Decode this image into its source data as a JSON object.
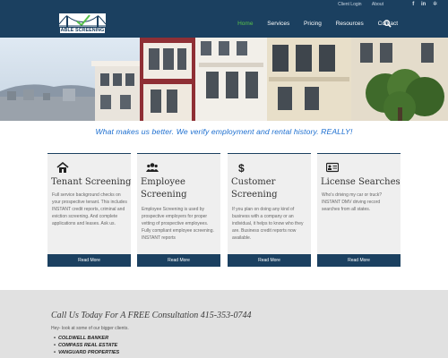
{
  "utility": {
    "links": [
      "Client Login",
      "About"
    ],
    "social": [
      {
        "name": "facebook-icon",
        "glyph": "f"
      },
      {
        "name": "linkedin-icon",
        "glyph": "in"
      },
      {
        "name": "yelp-icon",
        "glyph": "✲"
      }
    ]
  },
  "header": {
    "logo_text": "ABLE SCREENING",
    "nav": [
      "Home",
      "Services",
      "Pricing",
      "Resources",
      "Contact"
    ],
    "active_nav": "Home"
  },
  "tagline": "What makes us better. We verify employment and rental history. REALLY!",
  "services": [
    {
      "icon": "home-icon",
      "title": "Tenant Screening",
      "body": "Full service background checks on your prospective tenant. This includes INSTANT credit reports, criminal and eviction screening. And complete applications and leases. Ask us.",
      "button": "Read More"
    },
    {
      "icon": "users-icon",
      "title": "Employee Screening",
      "body": "Employee Screening is used by prospective employers for proper vetting of prospective employees. Fully compliant employee screening. INSTANT reports",
      "button": "Read More"
    },
    {
      "icon": "dollar-icon",
      "title": "Customer Screening",
      "body": "If you plan on doing any kind of business with a company or an individual, it helps to know who they are. Business credit reports now available.",
      "button": "Read More"
    },
    {
      "icon": "id-card-icon",
      "title": "License Searches",
      "body": "Who's driving my car or truck? INSTANT DMV driving record searches from all states.",
      "button": "Read More"
    }
  ],
  "cta": {
    "title": "Call Us Today For A FREE Consultation 415-353-0744",
    "subtitle": "Hey- look at some of our bigger clients.",
    "clients": [
      "COLDWELL BANKER",
      "COMPASS REAL ESTATE",
      "VANGUARD PROPERTIES"
    ]
  },
  "colors": {
    "brand_navy": "#1b4060",
    "accent_green": "#58c24a",
    "tagline_blue": "#1d6fd0"
  }
}
